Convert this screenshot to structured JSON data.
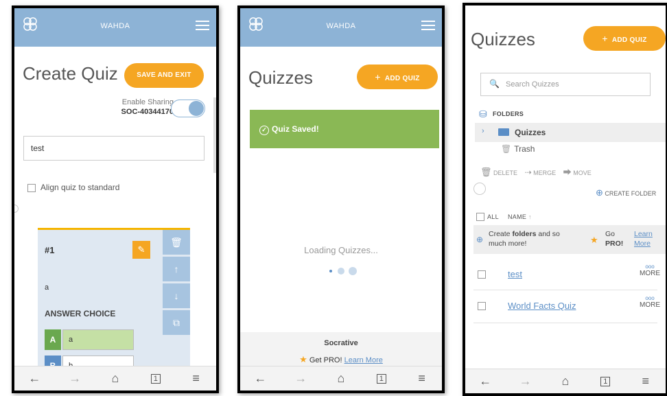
{
  "colors": {
    "header_blue": "#8db3d6",
    "accent_orange": "#f5a623",
    "success_green": "#8ab855",
    "link_blue": "#5b8ec6"
  },
  "header": {
    "brand": "WAHDA"
  },
  "navbar": {
    "icons": [
      "arrow-left-icon",
      "arrow-right-icon",
      "home-icon",
      "tabs-icon",
      "menu-icon"
    ],
    "tab_count": "1"
  },
  "screen1": {
    "title": "Create Quiz",
    "save_exit": "SAVE AND EXIT",
    "sharing_label": "Enable Sharing",
    "sharing_code": "SOC-40344170",
    "quiz_name_value": "test",
    "align_label": "Align quiz to standard",
    "question_number": "#1",
    "question_text": "a",
    "answer_heading": "ANSWER CHOICE",
    "choices": [
      {
        "letter": "A",
        "text": "a",
        "correct": true
      },
      {
        "letter": "B",
        "text": "b",
        "correct": false
      }
    ]
  },
  "screen2": {
    "title": "Quizzes",
    "add_quiz": "ADD QUIZ",
    "saved_msg": "Quiz Saved!",
    "loading": "Loading Quizzes...",
    "footer_brand": "Socrative",
    "get_pro": "Get PRO!",
    "learn_more": "Learn More"
  },
  "screen3": {
    "title": "Quizzes",
    "add_quiz": "ADD QUIZ",
    "search_placeholder": "Search Quizzes",
    "folders_label": "FOLDERS",
    "folder_quizzes": "Quizzes",
    "folder_trash": "Trash",
    "action_delete": "DELETE",
    "action_merge": "MERGE",
    "action_move": "MOVE",
    "create_folder": "CREATE FOLDER",
    "col_all": "ALL",
    "col_name": "NAME",
    "promo_text_pre": "Create ",
    "promo_text_bold": "folders",
    "promo_text_post": " and so much more!",
    "promo_go": "Go",
    "promo_pro": "PRO!",
    "promo_learn": "Learn",
    "promo_more": "More",
    "quizzes": [
      {
        "name": "test",
        "more": "MORE"
      },
      {
        "name": "World Facts Quiz",
        "more": "MORE"
      }
    ]
  }
}
